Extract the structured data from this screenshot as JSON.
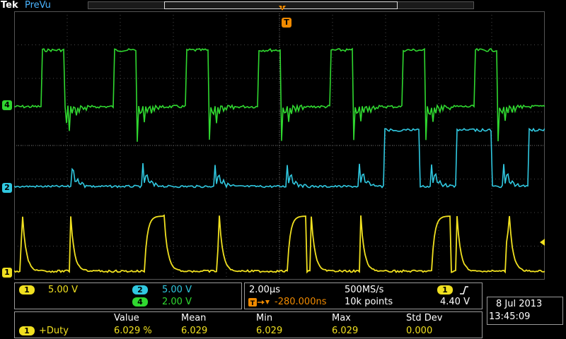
{
  "header": {
    "brand": "Tek",
    "mode": "PreVu"
  },
  "trigger_marker": "T",
  "channels": [
    {
      "id": "1",
      "color": "#f0e020",
      "scale": "5.00 V"
    },
    {
      "id": "2",
      "color": "#30c8e0",
      "scale": "5.00 V"
    },
    {
      "id": "4",
      "color": "#30d830",
      "scale": "2.00 V"
    }
  ],
  "timebase": {
    "scale": "2.00µs",
    "sample_rate": "500MS/s",
    "position": "280.000ns",
    "record_length": "10k points"
  },
  "trigger": {
    "source": "1",
    "slope_icon": "rising-edge-icon",
    "level": "4.40 V"
  },
  "datetime": {
    "date": "8 Jul  2013",
    "time": "13:45:09"
  },
  "measurement": {
    "headers": [
      "Value",
      "Mean",
      "Min",
      "Max",
      "Std Dev"
    ],
    "channel": "1",
    "name": "+Duty",
    "values": [
      "6.029 %",
      "6.029",
      "6.029",
      "6.029",
      "0.000"
    ]
  }
}
